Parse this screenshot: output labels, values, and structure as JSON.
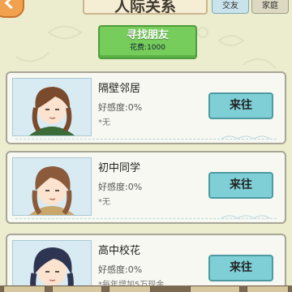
{
  "header": {
    "title": "人际关系",
    "tabs": [
      {
        "label": "交友",
        "active": true
      },
      {
        "label": "家庭",
        "active": false
      }
    ]
  },
  "find_friend": {
    "label": "寻找朋友",
    "cost": "花费:1000"
  },
  "contacts": [
    {
      "name": "隔壁邻居",
      "affinity": "好感度:0%",
      "note": "*无",
      "button": "来往"
    },
    {
      "name": "初中同学",
      "affinity": "好感度:0%",
      "note": "*无",
      "button": "来往"
    },
    {
      "name": "高中校花",
      "affinity": "好感度:0%",
      "note": "*每年增加5万现金",
      "button": "来往"
    }
  ],
  "colors": {
    "background": "#ecedcf",
    "find_button": "#77cd5b",
    "go_button": "#7ecfd6",
    "card": "#f8f8f2"
  }
}
